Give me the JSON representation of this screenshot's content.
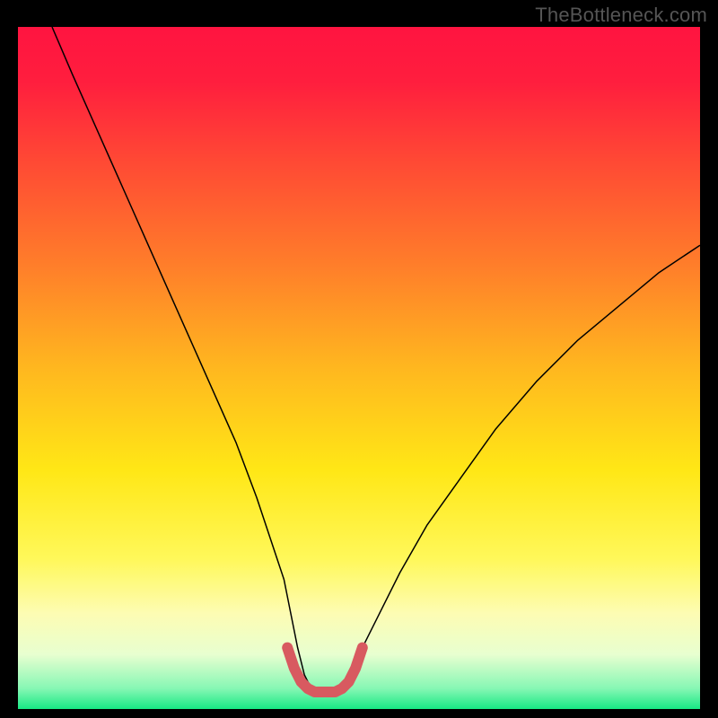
{
  "watermark": "TheBottleneck.com",
  "gradient": {
    "stops": [
      {
        "offset": 0.0,
        "color": "#ff1440"
      },
      {
        "offset": 0.08,
        "color": "#ff1e3e"
      },
      {
        "offset": 0.2,
        "color": "#ff4a34"
      },
      {
        "offset": 0.35,
        "color": "#ff7e2a"
      },
      {
        "offset": 0.5,
        "color": "#ffb71f"
      },
      {
        "offset": 0.65,
        "color": "#ffe716"
      },
      {
        "offset": 0.78,
        "color": "#fff85a"
      },
      {
        "offset": 0.86,
        "color": "#fdfcb3"
      },
      {
        "offset": 0.92,
        "color": "#e8ffd0"
      },
      {
        "offset": 0.97,
        "color": "#86f7b4"
      },
      {
        "offset": 1.0,
        "color": "#17e884"
      }
    ]
  },
  "chart_data": {
    "type": "line",
    "title": "",
    "xlabel": "",
    "ylabel": "",
    "xlim": [
      0,
      100
    ],
    "ylim": [
      0,
      100
    ],
    "series": [
      {
        "name": "curve",
        "color": "#000000",
        "width": 1.5,
        "x": [
          5,
          8,
          12,
          16,
          20,
          24,
          28,
          32,
          35,
          37,
          39,
          40,
          41,
          42,
          43,
          44,
          45,
          46,
          47,
          48,
          49,
          50,
          53,
          56,
          60,
          65,
          70,
          76,
          82,
          88,
          94,
          100
        ],
        "y": [
          100,
          93,
          84,
          75,
          66,
          57,
          48,
          39,
          31,
          25,
          19,
          14,
          9,
          5,
          3,
          2,
          2,
          2,
          2,
          3,
          5,
          8,
          14,
          20,
          27,
          34,
          41,
          48,
          54,
          59,
          64,
          68
        ]
      },
      {
        "name": "highlight",
        "color": "#d85a60",
        "width": 12,
        "cap": "round",
        "x": [
          39.5,
          40.5,
          41.5,
          42.5,
          43.5,
          44.5,
          45.5,
          46.5,
          47.5,
          48.5,
          49.5,
          50.5
        ],
        "y": [
          9,
          6,
          4,
          3,
          2.5,
          2.5,
          2.5,
          2.5,
          3,
          4,
          6,
          9
        ]
      }
    ]
  }
}
